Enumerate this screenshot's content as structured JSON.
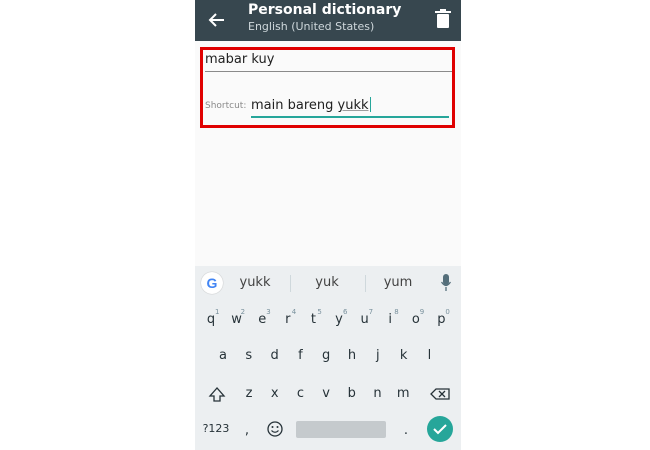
{
  "appbar": {
    "title": "Personal dictionary",
    "subtitle": "English (United States)",
    "back_icon": "arrow-left-icon",
    "delete_icon": "trash-icon",
    "bg_color": "#37474f"
  },
  "editor": {
    "word_value": "mabar kuy",
    "shortcut_label": "Shortcut:",
    "shortcut_value_prefix": "main bareng ",
    "shortcut_value_suffix": "yukk",
    "highlight_color": "#e00000",
    "accent_color": "#26a69a"
  },
  "keyboard": {
    "suggestions": [
      "yukk",
      "yuk",
      "yum"
    ],
    "row1": [
      "q",
      "w",
      "e",
      "r",
      "t",
      "y",
      "u",
      "i",
      "o",
      "p"
    ],
    "row1_hints": [
      "1",
      "2",
      "3",
      "4",
      "5",
      "6",
      "7",
      "8",
      "9",
      "0"
    ],
    "row2": [
      "a",
      "s",
      "d",
      "f",
      "g",
      "h",
      "j",
      "k",
      "l"
    ],
    "row3": [
      "z",
      "x",
      "c",
      "v",
      "b",
      "n",
      "m"
    ],
    "symbols_label": "?123",
    "comma": ",",
    "period": "."
  }
}
